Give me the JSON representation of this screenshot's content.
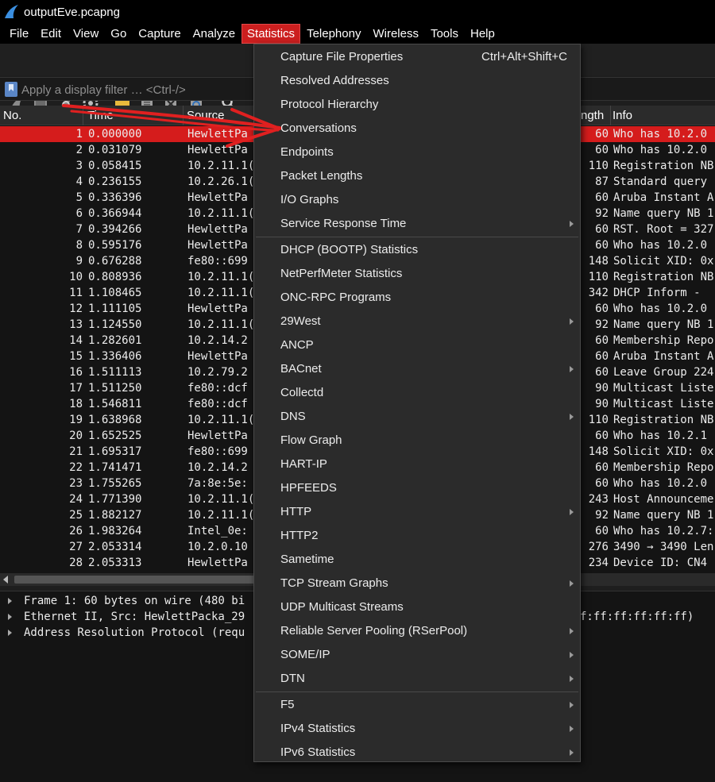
{
  "window": {
    "title": "outputEve.pcapng"
  },
  "menubar": {
    "items": [
      {
        "label": "File"
      },
      {
        "label": "Edit"
      },
      {
        "label": "View"
      },
      {
        "label": "Go"
      },
      {
        "label": "Capture"
      },
      {
        "label": "Analyze"
      },
      {
        "label": "Statistics"
      },
      {
        "label": "Telephony"
      },
      {
        "label": "Wireless"
      },
      {
        "label": "Tools"
      },
      {
        "label": "Help"
      }
    ],
    "active": "Statistics"
  },
  "toolbar": {
    "icons": [
      "start-capture-icon",
      "stop-capture-icon",
      "restart-capture-icon",
      "capture-options-icon",
      "open-file-icon",
      "save-file-icon",
      "close-file-icon",
      "reload-file-icon",
      "find-packet-icon"
    ]
  },
  "filter": {
    "placeholder": "Apply a display filter … <Ctrl-/>"
  },
  "packet_list": {
    "columns": {
      "no": "No.",
      "time": "Time",
      "source": "Source",
      "length": "ngth",
      "info": "Info"
    },
    "rows": [
      {
        "no": "1",
        "time": "0.000000",
        "src": "HewlettPa",
        "len": "60",
        "info": "Who has 10.2.0"
      },
      {
        "no": "2",
        "time": "0.031079",
        "src": "HewlettPa",
        "len": "60",
        "info": "Who has 10.2.0"
      },
      {
        "no": "3",
        "time": "0.058415",
        "src": "10.2.11.1(",
        "len": "110",
        "info": "Registration NB"
      },
      {
        "no": "4",
        "time": "0.236155",
        "src": "10.2.26.1(",
        "len": "87",
        "info": "Standard query"
      },
      {
        "no": "5",
        "time": "0.336396",
        "src": "HewlettPa",
        "len": "60",
        "info": "Aruba Instant A"
      },
      {
        "no": "6",
        "time": "0.366944",
        "src": "10.2.11.1(",
        "len": "92",
        "info": "Name query NB 1"
      },
      {
        "no": "7",
        "time": "0.394266",
        "src": "HewlettPa",
        "len": "60",
        "info": "RST. Root = 327"
      },
      {
        "no": "8",
        "time": "0.595176",
        "src": "HewlettPa",
        "len": "60",
        "info": "Who has 10.2.0"
      },
      {
        "no": "9",
        "time": "0.676288",
        "src": "fe80::699",
        "len": "148",
        "info": "Solicit XID: 0x"
      },
      {
        "no": "10",
        "time": "0.808936",
        "src": "10.2.11.1(",
        "len": "110",
        "info": "Registration NB"
      },
      {
        "no": "11",
        "time": "1.108465",
        "src": "10.2.11.1(",
        "len": "342",
        "info": "DHCP Inform   -"
      },
      {
        "no": "12",
        "time": "1.111105",
        "src": "HewlettPa",
        "len": "60",
        "info": "Who has 10.2.0"
      },
      {
        "no": "13",
        "time": "1.124550",
        "src": "10.2.11.1(",
        "len": "92",
        "info": "Name query NB 1"
      },
      {
        "no": "14",
        "time": "1.282601",
        "src": "10.2.14.2",
        "len": "60",
        "info": "Membership Repo"
      },
      {
        "no": "15",
        "time": "1.336406",
        "src": "HewlettPa",
        "len": "60",
        "info": "Aruba Instant A"
      },
      {
        "no": "16",
        "time": "1.511113",
        "src": "10.2.79.2",
        "len": "60",
        "info": "Leave Group 224"
      },
      {
        "no": "17",
        "time": "1.511250",
        "src": "fe80::dcf",
        "len": "90",
        "info": "Multicast Liste"
      },
      {
        "no": "18",
        "time": "1.546811",
        "src": "fe80::dcf",
        "len": "90",
        "info": "Multicast Liste"
      },
      {
        "no": "19",
        "time": "1.638968",
        "src": "10.2.11.1(",
        "len": "110",
        "info": "Registration NB"
      },
      {
        "no": "20",
        "time": "1.652525",
        "src": "HewlettPa",
        "len": "60",
        "info": "Who has 10.2.1"
      },
      {
        "no": "21",
        "time": "1.695317",
        "src": "fe80::699",
        "len": "148",
        "info": "Solicit XID: 0x"
      },
      {
        "no": "22",
        "time": "1.741471",
        "src": "10.2.14.2",
        "len": "60",
        "info": "Membership Repo"
      },
      {
        "no": "23",
        "time": "1.755265",
        "src": "7a:8e:5e:",
        "len": "60",
        "info": "Who has 10.2.0"
      },
      {
        "no": "24",
        "time": "1.771390",
        "src": "10.2.11.1(",
        "len": "243",
        "info": "Host Announceme"
      },
      {
        "no": "25",
        "time": "1.882127",
        "src": "10.2.11.1(",
        "len": "92",
        "info": "Name query NB 1"
      },
      {
        "no": "26",
        "time": "1.983264",
        "src": "Intel_0e:",
        "len": "60",
        "info": "Who has 10.2.7:"
      },
      {
        "no": "27",
        "time": "2.053314",
        "src": "10.2.0.10",
        "len": "276",
        "info": "3490 → 3490 Len"
      },
      {
        "no": "28",
        "time": "2.053313",
        "src": "HewlettPa",
        "len": "234",
        "info": "Device ID: CN4"
      }
    ]
  },
  "details": {
    "rows": [
      {
        "text": "Frame 1: 60 bytes on wire (480 bi",
        "tail": ""
      },
      {
        "text": "Ethernet II, Src: HewlettPacka_29",
        "tail": "f:ff:ff:ff:ff:ff)"
      },
      {
        "text": "Address Resolution Protocol (requ",
        "tail": ""
      }
    ]
  },
  "statistics_menu": {
    "items": [
      {
        "label": "Capture File Properties",
        "shortcut": "Ctrl+Alt+Shift+C",
        "submenu": false
      },
      {
        "label": "Resolved Addresses",
        "shortcut": "",
        "submenu": false
      },
      {
        "label": "Protocol Hierarchy",
        "shortcut": "",
        "submenu": false
      },
      {
        "label": "Conversations",
        "shortcut": "",
        "submenu": false
      },
      {
        "label": "Endpoints",
        "shortcut": "",
        "submenu": false
      },
      {
        "label": "Packet Lengths",
        "shortcut": "",
        "submenu": false
      },
      {
        "label": "I/O Graphs",
        "shortcut": "",
        "submenu": false
      },
      {
        "label": "Service Response Time",
        "shortcut": "",
        "submenu": true
      },
      {
        "separator": true
      },
      {
        "label": "DHCP (BOOTP) Statistics",
        "shortcut": "",
        "submenu": false
      },
      {
        "label": "NetPerfMeter Statistics",
        "shortcut": "",
        "submenu": false
      },
      {
        "label": "ONC-RPC Programs",
        "shortcut": "",
        "submenu": false
      },
      {
        "label": "29West",
        "shortcut": "",
        "submenu": true
      },
      {
        "label": "ANCP",
        "shortcut": "",
        "submenu": false
      },
      {
        "label": "BACnet",
        "shortcut": "",
        "submenu": true
      },
      {
        "label": "Collectd",
        "shortcut": "",
        "submenu": false
      },
      {
        "label": "DNS",
        "shortcut": "",
        "submenu": true
      },
      {
        "label": "Flow Graph",
        "shortcut": "",
        "submenu": false
      },
      {
        "label": "HART-IP",
        "shortcut": "",
        "submenu": false
      },
      {
        "label": "HPFEEDS",
        "shortcut": "",
        "submenu": false
      },
      {
        "label": "HTTP",
        "shortcut": "",
        "submenu": true
      },
      {
        "label": "HTTP2",
        "shortcut": "",
        "submenu": false
      },
      {
        "label": "Sametime",
        "shortcut": "",
        "submenu": false
      },
      {
        "label": "TCP Stream Graphs",
        "shortcut": "",
        "submenu": true
      },
      {
        "label": "UDP Multicast Streams",
        "shortcut": "",
        "submenu": false
      },
      {
        "label": "Reliable Server Pooling (RSerPool)",
        "shortcut": "",
        "submenu": true
      },
      {
        "label": "SOME/IP",
        "shortcut": "",
        "submenu": true
      },
      {
        "label": "DTN",
        "shortcut": "",
        "submenu": true
      },
      {
        "separator": true
      },
      {
        "label": "F5",
        "shortcut": "",
        "submenu": true
      },
      {
        "label": "IPv4 Statistics",
        "shortcut": "",
        "submenu": true
      },
      {
        "label": "IPv6 Statistics",
        "shortcut": "",
        "submenu": true
      }
    ]
  },
  "colors": {
    "selected_row": "#d51c1c",
    "menu_active": "#cc1f1f",
    "annotation": "#e02020"
  }
}
